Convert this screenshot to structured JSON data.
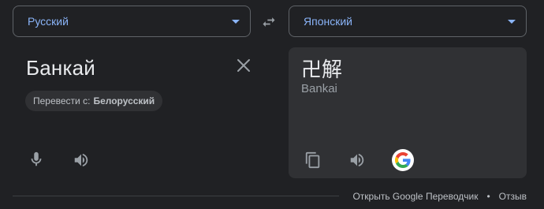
{
  "source_language": {
    "label": "Русский"
  },
  "target_language": {
    "label": "Японский"
  },
  "source": {
    "text": "Банкай",
    "detect_prefix": "Перевести с:",
    "detected_language": "Белорусский"
  },
  "result": {
    "text": "卍解",
    "transliteration": "Bankai"
  },
  "footer": {
    "open_link": "Открыть Google Переводчик",
    "separator": "•",
    "feedback_link": "Отзыв"
  },
  "icons": [
    "swap-icon",
    "close-icon",
    "mic-icon",
    "speaker-icon",
    "copy-icon",
    "google-icon",
    "chevron-down-icon"
  ],
  "colors": {
    "background": "#202124",
    "card": "#303134",
    "accent": "#8ab4f8",
    "text": "#e8eaed",
    "muted": "#9aa0a6"
  }
}
